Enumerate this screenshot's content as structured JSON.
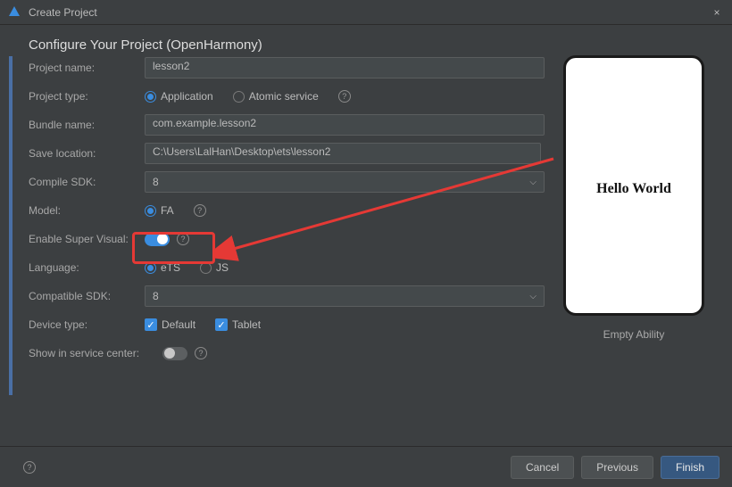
{
  "window": {
    "title": "Create Project",
    "close": "×"
  },
  "heading": "Configure Your Project (OpenHarmony)",
  "form": {
    "projectName": {
      "label": "Project name:",
      "value": "lesson2"
    },
    "projectType": {
      "label": "Project type:",
      "optApplication": "Application",
      "optAtomic": "Atomic service"
    },
    "bundleName": {
      "label": "Bundle name:",
      "value": "com.example.lesson2"
    },
    "saveLocation": {
      "label": "Save location:",
      "value": "C:\\Users\\LalHan\\Desktop\\ets\\lesson2"
    },
    "compileSdk": {
      "label": "Compile SDK:",
      "value": "8"
    },
    "model": {
      "label": "Model:",
      "optFA": "FA"
    },
    "enableSuperVisual": {
      "label": "Enable Super Visual:"
    },
    "language": {
      "label": "Language:",
      "optETS": "eTS",
      "optJS": "JS"
    },
    "compatibleSdk": {
      "label": "Compatible SDK:",
      "value": "8"
    },
    "deviceType": {
      "label": "Device type:",
      "optDefault": "Default",
      "optTablet": "Tablet"
    },
    "showInServiceCenter": {
      "label": "Show in service center:"
    }
  },
  "preview": {
    "text": "Hello World",
    "caption": "Empty Ability"
  },
  "footer": {
    "cancel": "Cancel",
    "previous": "Previous",
    "finish": "Finish"
  },
  "helpGlyph": "?"
}
